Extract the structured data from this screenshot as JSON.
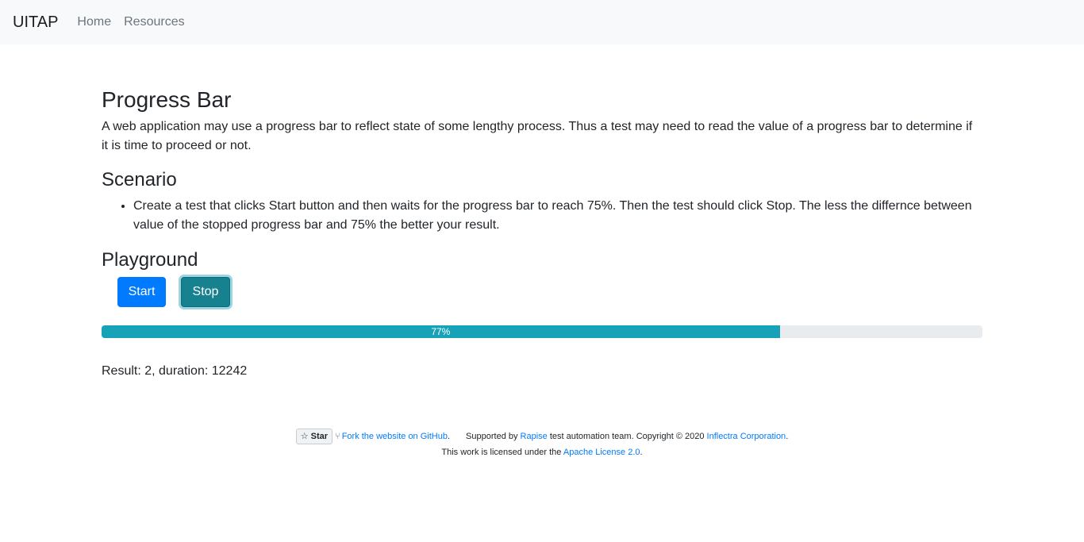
{
  "nav": {
    "brand": "UITAP",
    "links": [
      "Home",
      "Resources"
    ]
  },
  "page": {
    "title": "Progress Bar",
    "intro": "A web application may use a progress bar to reflect state of some lengthy process. Thus a test may need to read the value of a progress bar to determine if it is time to proceed or not.",
    "scenario_title": "Scenario",
    "scenario_items": [
      "Create a test that clicks Start button and then waits for the progress bar to reach 75%. Then the test should click Stop. The less the differnce between value of the stopped progress bar and 75% the better your result."
    ],
    "playground_title": "Playground"
  },
  "buttons": {
    "start": "Start",
    "stop": "Stop"
  },
  "progress": {
    "value": 77,
    "label": "77%"
  },
  "result": "Result: 2, duration: 12242",
  "footer": {
    "star": "Star",
    "fork_link": "Fork the website on GitHub",
    "supported_prefix": "Supported by ",
    "rapise_link": "Rapise",
    "supported_middle": " test automation team. Copyright © 2020 ",
    "inflectra_link": "Inflectra Corporation",
    "license_prefix": "This work is licensed under the ",
    "license_link": "Apache License 2.0"
  },
  "colors": {
    "start_button": "#007bff",
    "stop_button": "#17818f",
    "progress_fill": "#17a2b8",
    "progress_track": "#e9ecef"
  },
  "icons": [
    "star-icon",
    "fork-icon"
  ]
}
